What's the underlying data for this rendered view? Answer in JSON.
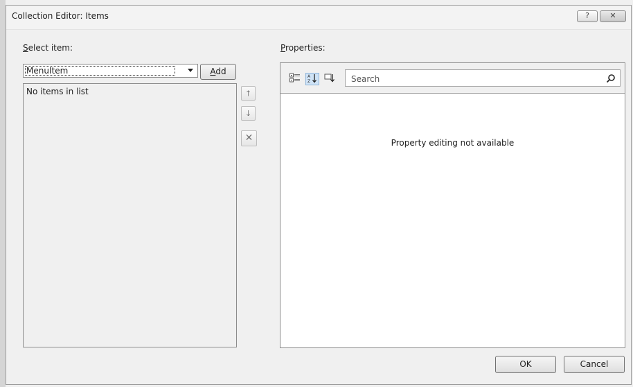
{
  "window": {
    "title": "Collection Editor: Items",
    "help_glyph": "?",
    "close_glyph": "✕"
  },
  "select_item": {
    "label_mnemonic": "S",
    "label_rest": "elect item:",
    "combo_value": "MenuItem",
    "add_mnemonic": "A",
    "add_rest": "dd",
    "empty_message": "No items in list"
  },
  "item_actions": {
    "move_up_glyph": "🡑",
    "move_down_glyph": "🡓",
    "remove_glyph": "✕"
  },
  "properties": {
    "label_mnemonic": "P",
    "label_rest": "roperties:",
    "search_placeholder": "Search",
    "empty_message": "Property editing not available"
  },
  "footer": {
    "ok_label": "OK",
    "cancel_label": "Cancel"
  },
  "icons": {
    "categorized": "categorized-view-icon",
    "alphabetical": "alphabetical-sort-icon",
    "events": "events-view-icon",
    "search": "search-icon"
  }
}
